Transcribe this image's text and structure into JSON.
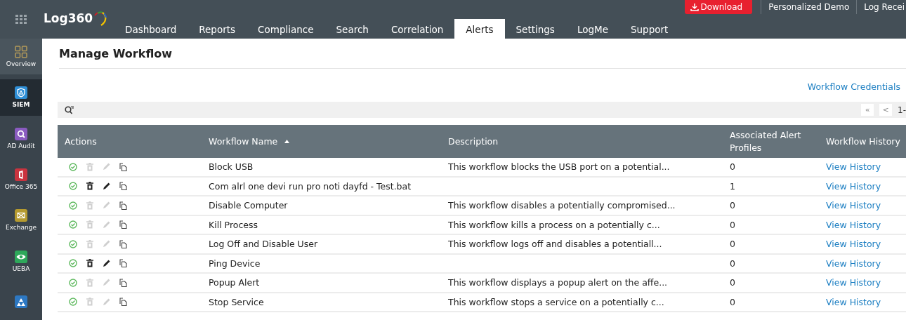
{
  "app": {
    "brand": "Log360"
  },
  "top_links": [
    {
      "label": "Download",
      "kind": "download"
    },
    {
      "label": "Personalized Demo",
      "kind": "link"
    },
    {
      "label": "Log Recei",
      "kind": "link"
    }
  ],
  "tabs": [
    {
      "label": "Dashboard",
      "selected": false
    },
    {
      "label": "Reports",
      "selected": false
    },
    {
      "label": "Compliance",
      "selected": false
    },
    {
      "label": "Search",
      "selected": false
    },
    {
      "label": "Correlation",
      "selected": false
    },
    {
      "label": "Alerts",
      "selected": true
    },
    {
      "label": "Settings",
      "selected": false
    },
    {
      "label": "LogMe",
      "selected": false
    },
    {
      "label": "Support",
      "selected": false
    }
  ],
  "sidebar": {
    "items": [
      {
        "label": "Overview",
        "kind": "overview",
        "color": "#b49a5a",
        "selected": false
      },
      {
        "label": "SIEM",
        "kind": "siem",
        "color": "#2f8fd6",
        "selected": true
      },
      {
        "label": "AD Audit",
        "kind": "audit",
        "color": "#8a5bc0",
        "selected": false
      },
      {
        "label": "Office 365",
        "kind": "office",
        "color": "#c9343f",
        "selected": false
      },
      {
        "label": "Exchange",
        "kind": "exchange",
        "color": "#b59a2f",
        "selected": false
      },
      {
        "label": "UEBA",
        "kind": "ueba",
        "color": "#2ea85a",
        "selected": false
      },
      {
        "kind": "cloud",
        "color": "#2d78c2",
        "selected": false
      }
    ]
  },
  "page": {
    "title": "Manage Workflow",
    "credentials_link": "Workflow Credentials"
  },
  "pagination": {
    "first": "«",
    "prev": "<",
    "range": "1-"
  },
  "table": {
    "columns": [
      {
        "label": "Actions",
        "sorted": false
      },
      {
        "label": "Workflow Name",
        "sorted": true
      },
      {
        "label": "Description",
        "sorted": false
      },
      {
        "label": "Associated Alert Profiles",
        "sorted": false
      },
      {
        "label": "Workflow History",
        "sorted": false
      }
    ],
    "rows": [
      {
        "name": "Block USB",
        "description": "This workflow blocks the USB port on a potential...",
        "profiles": "0",
        "history": "View History",
        "editable": false
      },
      {
        "name": "Com alrl one devi run pro noti dayfd - Test.bat",
        "description": "",
        "profiles": "1",
        "history": "View History",
        "editable": true
      },
      {
        "name": "Disable Computer",
        "description": "This workflow disables a potentially compromised...",
        "profiles": "0",
        "history": "View History",
        "editable": false
      },
      {
        "name": "Kill Process",
        "description": "This workflow kills a process on a potentially c...",
        "profiles": "0",
        "history": "View History",
        "editable": false
      },
      {
        "name": "Log Off and Disable User",
        "description": "This workflow logs off and disables a potentiall...",
        "profiles": "0",
        "history": "View History",
        "editable": false
      },
      {
        "name": "Ping Device",
        "description": "",
        "profiles": "0",
        "history": "View History",
        "editable": true
      },
      {
        "name": "Popup Alert",
        "description": "This workflow displays a popup alert on the affe...",
        "profiles": "0",
        "history": "View History",
        "editable": false
      },
      {
        "name": "Stop Service",
        "description": "This workflow stops a service on a potentially c...",
        "profiles": "0",
        "history": "View History",
        "editable": false
      }
    ]
  }
}
